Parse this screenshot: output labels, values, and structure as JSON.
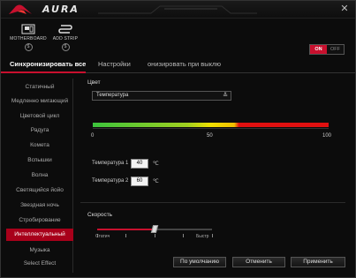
{
  "app": {
    "title": "AURA"
  },
  "devices": [
    {
      "label": "MOTHERBOARD",
      "badge": "$"
    },
    {
      "label": "ADD STRIP",
      "badge": "$"
    }
  ],
  "power_toggle": {
    "on": "ON",
    "off": "OFF",
    "state": "on"
  },
  "tabs": [
    {
      "label": "Синхронизировать все"
    },
    {
      "label": "Настройки"
    },
    {
      "label": "онизировать при выклю"
    }
  ],
  "sidebar": {
    "items": [
      {
        "label": "Статичный"
      },
      {
        "label": "Медленно мигающий"
      },
      {
        "label": "Цветовой цикл"
      },
      {
        "label": "Радуга"
      },
      {
        "label": "Комета"
      },
      {
        "label": "Вспышки"
      },
      {
        "label": "Волна"
      },
      {
        "label": "Светящийся йойо"
      },
      {
        "label": "Звездная ночь"
      },
      {
        "label": "Стробирование"
      },
      {
        "label": "Интеллектуальный"
      },
      {
        "label": "Музыка"
      },
      {
        "label": "Select Effect"
      }
    ],
    "active_index": 10
  },
  "color_section": {
    "label": "Цвет",
    "dropdown_value": "Температура",
    "scale_min": "0",
    "scale_mid": "50",
    "scale_max": "100"
  },
  "temperatures": [
    {
      "label": "Температура 1",
      "value": "40",
      "unit": "℃"
    },
    {
      "label": "Температура 2",
      "value": "60",
      "unit": "℃"
    }
  ],
  "speed": {
    "label": "Скорость",
    "slow_label": "Статич",
    "fast_label": "Быстр",
    "value_fraction": 0.5
  },
  "buttons": {
    "default": "По умолчанию",
    "cancel": "Отменить",
    "apply": "Применить"
  },
  "colors": {
    "accent": "#c8102e"
  }
}
